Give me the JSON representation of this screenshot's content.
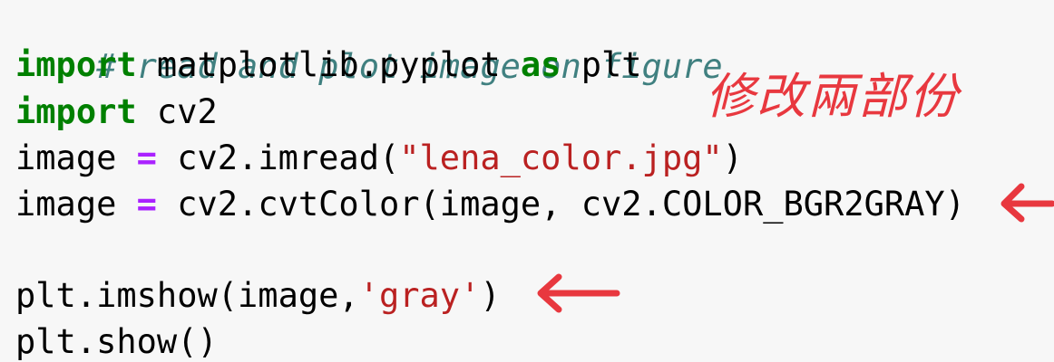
{
  "code": {
    "line1": {
      "comment": "# read and plot image on figure"
    },
    "line2": {
      "kw1": "import",
      "text1": " matplotlib.pyplot ",
      "kw2": "as",
      "text2": " plt"
    },
    "line3": {
      "kw1": "import",
      "text1": " cv2"
    },
    "line4": {
      "text1": "image ",
      "op": "=",
      "text2": " cv2.imread(",
      "str": "\"lena_color.jpg\"",
      "text3": ")"
    },
    "line5": {
      "text1": "image ",
      "op": "=",
      "text2": " cv2.cvtColor(image, cv2.COLOR_BGR2GRAY)"
    },
    "line7": {
      "text1": "plt.imshow(image,",
      "str": "'gray'",
      "text2": ")"
    },
    "line8": {
      "text1": "plt.show()"
    }
  },
  "annotation": {
    "handwritten_note": "修改兩部份",
    "arrow_color": "#e8383f"
  }
}
